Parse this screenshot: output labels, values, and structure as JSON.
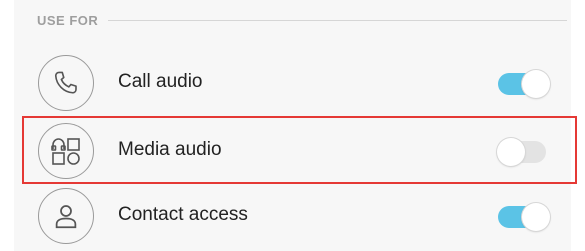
{
  "section": {
    "title": "USE FOR"
  },
  "rows": [
    {
      "label": "Call audio",
      "icon": "phone-icon",
      "enabled": true
    },
    {
      "label": "Media audio",
      "icon": "media-icon",
      "enabled": false
    },
    {
      "label": "Contact access",
      "icon": "contact-icon",
      "enabled": true
    }
  ],
  "colors": {
    "toggle_on": "#5bc3e6",
    "toggle_off": "#e3e3e3",
    "highlight": "#e53935"
  }
}
